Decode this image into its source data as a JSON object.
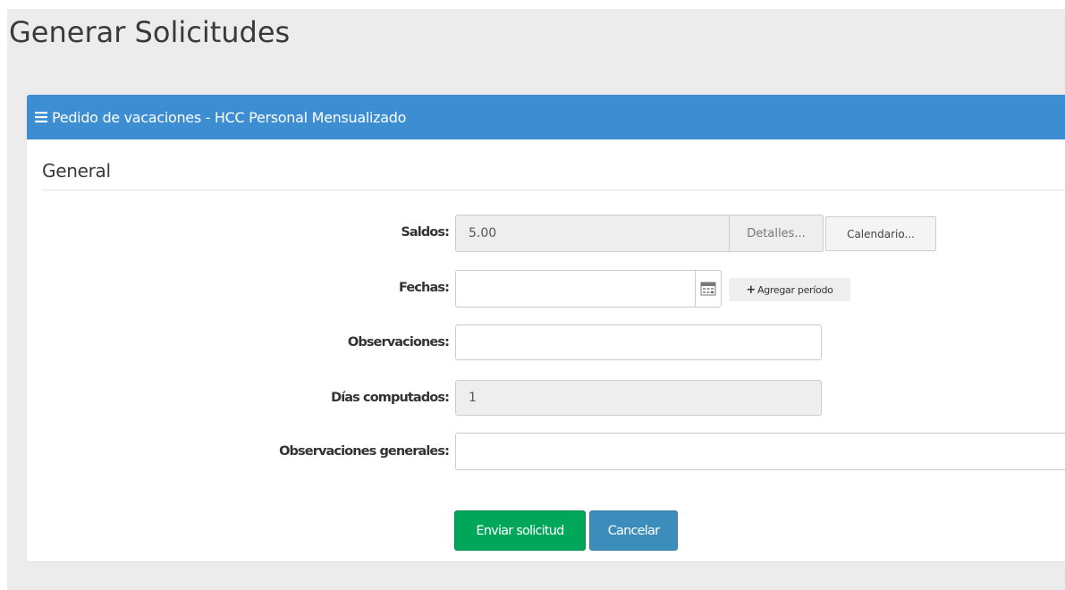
{
  "page": {
    "title": "Generar Solicitudes"
  },
  "panel": {
    "menu_icon": "bars-icon",
    "title": "Pedido de vacaciones - HCC Personal Mensualizado",
    "header_color": "#3c8dd2",
    "section_title": "General"
  },
  "form": {
    "saldos": {
      "label": "Saldos:",
      "value": "5.00",
      "detalles_label": "Detalles...",
      "calendario_label": "Calendario..."
    },
    "fechas": {
      "label": "Fechas:",
      "value": "",
      "calendar_icon": "calendar-icon",
      "agregar_icon": "plus-icon",
      "agregar_label": "Agregar período"
    },
    "observaciones": {
      "label": "Observaciones:",
      "value": ""
    },
    "dias_computados": {
      "label": "Días computados:",
      "value": "1"
    },
    "observaciones_generales": {
      "label": "Observaciones generales:",
      "value": ""
    }
  },
  "actions": {
    "enviar_label": "Enviar solicitud",
    "enviar_color": "#00a65a",
    "cancelar_label": "Cancelar",
    "cancelar_color": "#3c8dbc"
  }
}
